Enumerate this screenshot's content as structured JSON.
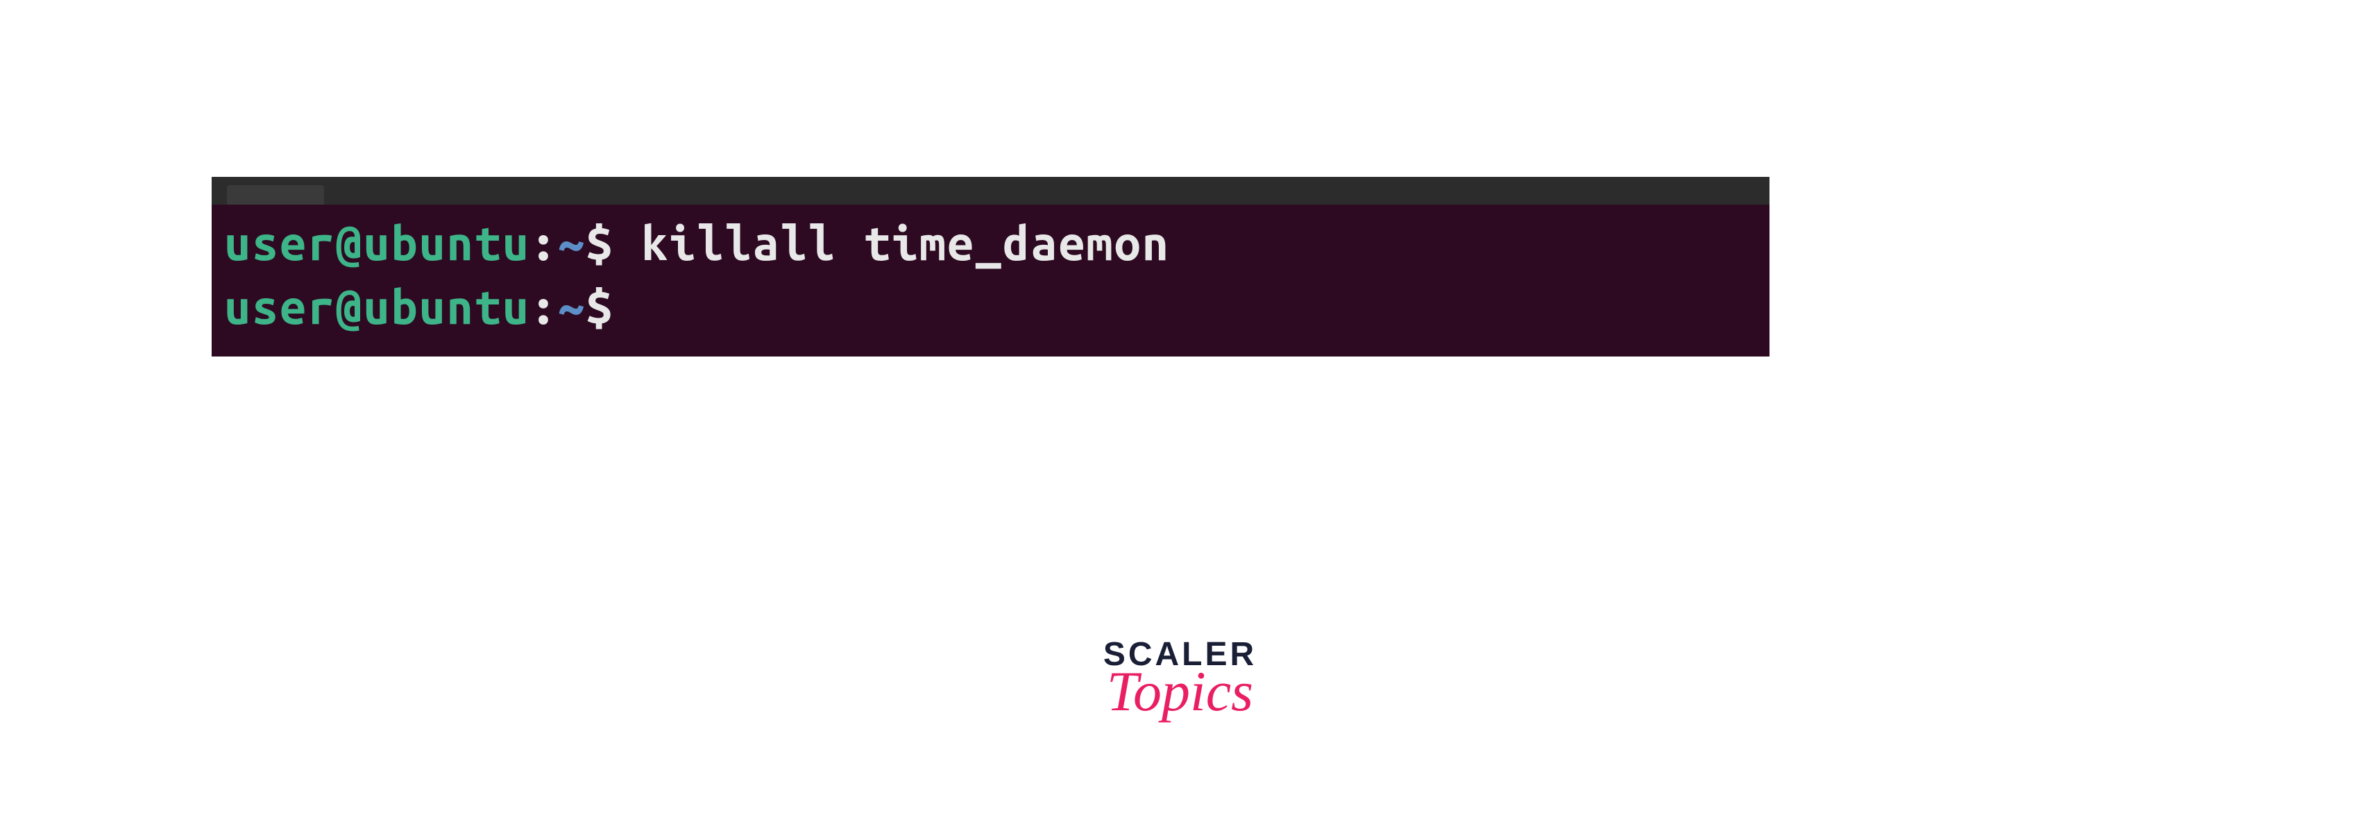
{
  "terminal": {
    "lines": [
      {
        "user": "user@ubuntu",
        "path": "~",
        "command": "killall time_daemon"
      },
      {
        "user": "user@ubuntu",
        "path": "~",
        "command": ""
      }
    ]
  },
  "logo": {
    "line1": "SCALER",
    "line2": "Topics"
  }
}
